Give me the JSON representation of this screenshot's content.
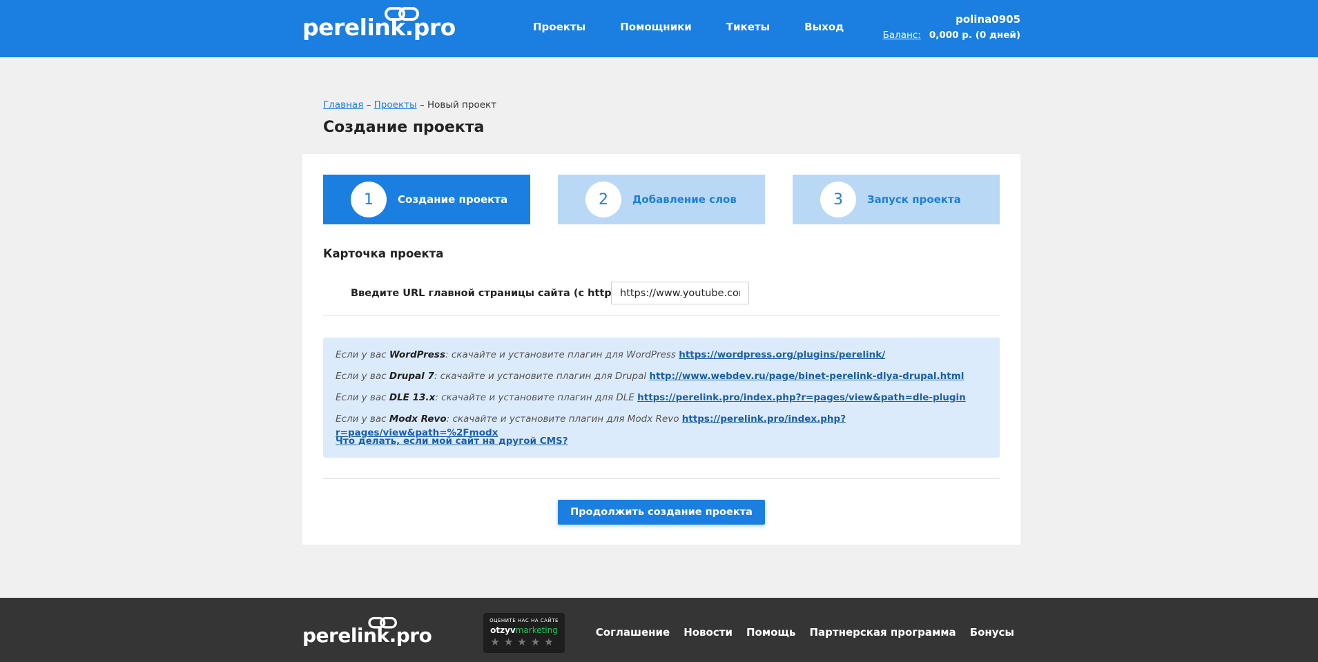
{
  "header": {
    "logo": "perelink.pro",
    "nav": [
      "Проекты",
      "Помощники",
      "Тикеты",
      "Выход"
    ],
    "username": "polina0905",
    "balance_label": "Баланс:",
    "balance_value": "0,000 р. (0 дней)"
  },
  "breadcrumb": {
    "home": "Главная",
    "sep1": " – ",
    "projects": "Проекты",
    "sep2": " – ",
    "current": "Новый проект"
  },
  "page_title": "Создание проекта",
  "steps": [
    {
      "num": "1",
      "label": "Создание проекта",
      "active": true
    },
    {
      "num": "2",
      "label": "Добавление слов",
      "active": false
    },
    {
      "num": "3",
      "label": "Запуск проекта",
      "active": false
    }
  ],
  "section_title": "Карточка проекта",
  "url_field": {
    "label": "Введите URL главной страницы сайта (с http/https):",
    "value": "https://www.youtube.com"
  },
  "info": {
    "wp": {
      "prefix": "Если у вас ",
      "cms": "WordPress",
      "text": ": скачайте и установите плагин для WordPress ",
      "link": "https://wordpress.org/plugins/perelink/"
    },
    "drupal": {
      "prefix": "Если у вас ",
      "cms": "Drupal 7",
      "text": ": скачайте и установите плагин для Drupal ",
      "link": "http://www.webdev.ru/page/binet-perelink-dlya-drupal.html"
    },
    "dle": {
      "prefix": "Если у вас ",
      "cms": "DLE 13.x",
      "text": ": скачайте и установите плагин для DLE ",
      "link": "https://perelink.pro/index.php?r=pages/view&path=dle-plugin"
    },
    "modx": {
      "prefix": "Если у вас ",
      "cms": "Modx Revo",
      "text": ": скачайте и установите плагин для Modx Revo ",
      "link": "https://perelink.pro/index.php?r=pages/view&path=%2Fmodx"
    },
    "other_cms": "Что делать, если мой сайт на другой CMS?"
  },
  "continue_button": "Продолжить создание проекта",
  "footer": {
    "logo": "perelink.pro",
    "badge_top": "ОЦЕНИТЕ НАС НА САЙТЕ",
    "badge_brand_a": "otzyv",
    "badge_brand_b": "marketing",
    "badge_stars": "★★★★★",
    "nav": [
      "Соглашение",
      "Новости",
      "Помощь",
      "Партнерская программа",
      "Бонусы"
    ]
  },
  "colors": {
    "accent": "#1a7fe0",
    "step_inactive": "#b9d8f6",
    "info_bg": "#dcebfb",
    "footer_bg": "#353535"
  }
}
